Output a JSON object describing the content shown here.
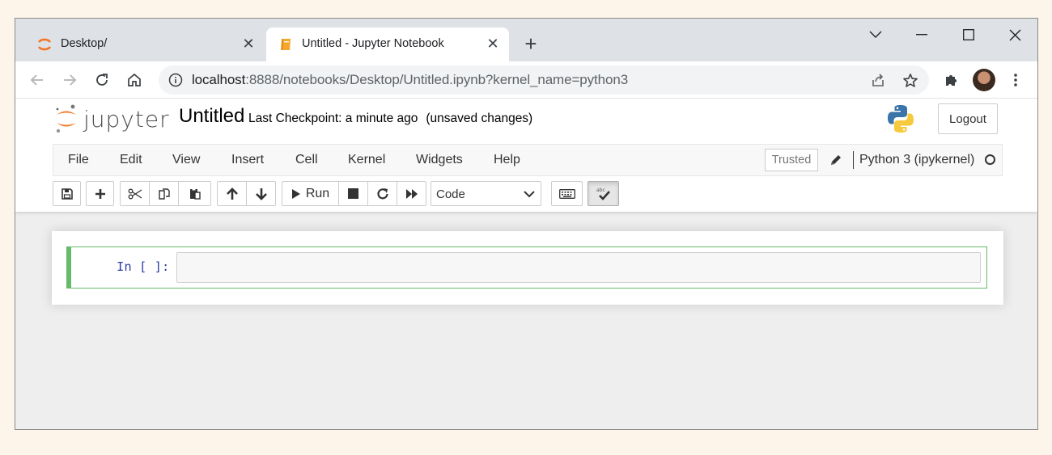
{
  "browser": {
    "tabs": [
      {
        "title": "Desktop/",
        "icon": "jupyter-logo-icon",
        "active": false
      },
      {
        "title": "Untitled - Jupyter Notebook",
        "icon": "notebook-icon",
        "active": true
      }
    ],
    "close_glyph": "✕",
    "newtab_glyph": "+",
    "url_host": "localhost",
    "url_rest": ":8888/notebooks/Desktop/Untitled.ipynb?kernel_name=python3"
  },
  "jupyter": {
    "logo_text": "jupyter",
    "notebook_name": "Untitled",
    "checkpoint": "Last Checkpoint: a minute ago",
    "unsaved": "(unsaved changes)",
    "logout_label": "Logout",
    "menu": [
      "File",
      "Edit",
      "View",
      "Insert",
      "Cell",
      "Kernel",
      "Widgets",
      "Help"
    ],
    "trusted_label": "Trusted",
    "kernel_name": "Python 3 (ipykernel)",
    "run_label": "Run",
    "cell_type": "Code",
    "cell_type_options": [
      "Code"
    ],
    "prompt": "In [ ]:"
  },
  "colors": {
    "accent_orange": "#f37726",
    "cell_selected_border": "#66bb6a",
    "prompt_blue": "#303f9f"
  }
}
